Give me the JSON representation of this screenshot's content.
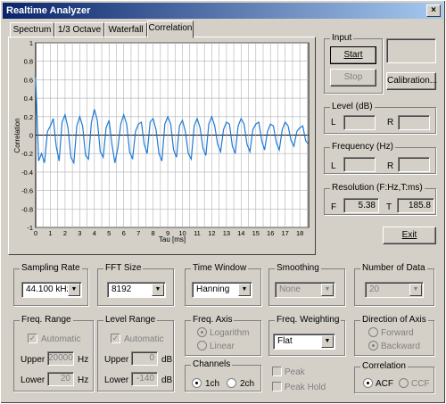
{
  "window": {
    "title": "Realtime Analyzer",
    "close_label": "×"
  },
  "tabs": [
    {
      "label": "Spectrum"
    },
    {
      "label": "1/3 Octave"
    },
    {
      "label": "Waterfall"
    },
    {
      "label": "Correlation",
      "active": true
    }
  ],
  "input": {
    "title": "Input",
    "start_label": "Start",
    "stop_label": "Stop",
    "calibration_label": "Calibration..."
  },
  "level": {
    "title": "Level (dB)",
    "l_label": "L",
    "r_label": "R",
    "l_value": "",
    "r_value": ""
  },
  "frequency": {
    "title": "Frequency (Hz)",
    "l_label": "L",
    "r_label": "R",
    "l_value": "",
    "r_value": ""
  },
  "resolution": {
    "title": "Resolution (F:Hz,T:ms)",
    "f_label": "F",
    "f_value": "5.38",
    "t_label": "T",
    "t_value": "185.8"
  },
  "exit_label": "Exit",
  "sampling_rate": {
    "title": "Sampling Rate",
    "value": "44.100 kHz"
  },
  "fft_size": {
    "title": "FFT Size",
    "value": "8192"
  },
  "time_window": {
    "title": "Time Window",
    "value": "Hanning"
  },
  "smoothing": {
    "title": "Smoothing",
    "value": "None"
  },
  "number_of_data": {
    "title": "Number of Data",
    "value": "20"
  },
  "freq_range": {
    "title": "Freq. Range",
    "automatic_label": "Automatic",
    "upper_label": "Upper",
    "upper_value": "20000",
    "upper_unit": "Hz",
    "lower_label": "Lower",
    "lower_value": "20",
    "lower_unit": "Hz"
  },
  "level_range": {
    "title": "Level Range",
    "automatic_label": "Automatic",
    "upper_label": "Upper",
    "upper_value": "0",
    "upper_unit": "dB",
    "lower_label": "Lower",
    "lower_value": "-140",
    "lower_unit": "dB"
  },
  "freq_axis": {
    "title": "Freq. Axis",
    "logarithm_label": "Logarithm",
    "linear_label": "Linear"
  },
  "freq_weighting": {
    "title": "Freq. Weighting",
    "value": "Flat"
  },
  "direction": {
    "title": "Direction of Axis",
    "forward_label": "Forward",
    "backward_label": "Backward"
  },
  "channels": {
    "title": "Channels",
    "ch1_label": "1ch",
    "ch2_label": "2ch"
  },
  "peak": {
    "peak_label": "Peak",
    "peak_hold_label": "Peak Hold"
  },
  "correlation": {
    "title": "Correlation",
    "acf_label": "ACF",
    "ccf_label": "CCF"
  },
  "chart_data": {
    "type": "line",
    "xlabel": "Tau [ms]",
    "ylabel": "Correlation",
    "xlim": [
      0,
      18.6
    ],
    "ylim": [
      -1,
      1
    ],
    "grid": true,
    "series_color": "#1e7ad6",
    "x_ticks": [
      "0",
      "1",
      "2",
      "3",
      "4",
      "5",
      "6",
      "7",
      "8",
      "9",
      "10",
      "11",
      "12",
      "13",
      "14",
      "15",
      "16",
      "17",
      "18"
    ],
    "y_ticks": [
      "1",
      "0.8",
      "0.6",
      "0.4",
      "0.2",
      "0",
      "-0.2",
      "-0.4",
      "-0.6",
      "-0.8",
      "-1"
    ],
    "series": [
      {
        "x": [
          0,
          0.2,
          0.4,
          0.6,
          0.8,
          1.0,
          1.2,
          1.4,
          1.6,
          1.8,
          2.0,
          2.2,
          2.4,
          2.6,
          2.8,
          3.0,
          3.2,
          3.4,
          3.6,
          3.8,
          4.0,
          4.2,
          4.4,
          4.6,
          4.8,
          5.0,
          5.2,
          5.4,
          5.6,
          5.8,
          6.0,
          6.2,
          6.4,
          6.6,
          6.8,
          7.0,
          7.2,
          7.4,
          7.6,
          7.8,
          8.0,
          8.2,
          8.4,
          8.6,
          8.8,
          9.0,
          9.2,
          9.4,
          9.6,
          9.8,
          10.0,
          10.2,
          10.4,
          10.6,
          10.8,
          11.0,
          11.2,
          11.4,
          11.6,
          11.8,
          12.0,
          12.2,
          12.4,
          12.6,
          12.8,
          13.0,
          13.2,
          13.4,
          13.6,
          13.8,
          14.0,
          14.2,
          14.4,
          14.6,
          14.8,
          15.0,
          15.2,
          15.4,
          15.6,
          15.8,
          16.0,
          16.2,
          16.4,
          16.6,
          16.8,
          17.0,
          17.2,
          17.4,
          17.6,
          17.8,
          18.0,
          18.2,
          18.4,
          18.6
        ],
        "y": [
          0.62,
          -0.28,
          -0.2,
          -0.3,
          0.04,
          0.1,
          0.18,
          -0.12,
          -0.28,
          0.14,
          0.22,
          0.08,
          -0.24,
          -0.3,
          0.1,
          0.2,
          0.1,
          -0.22,
          -0.26,
          0.14,
          0.28,
          0.16,
          -0.18,
          -0.24,
          0.08,
          0.16,
          -0.1,
          -0.3,
          -0.14,
          0.12,
          0.22,
          0.12,
          -0.18,
          -0.26,
          0.04,
          0.12,
          0.14,
          -0.1,
          -0.2,
          0.14,
          0.18,
          0.06,
          -0.2,
          -0.28,
          0.12,
          0.2,
          0.12,
          -0.16,
          -0.24,
          0.1,
          0.16,
          0.04,
          -0.2,
          -0.26,
          0.1,
          0.18,
          0.08,
          -0.14,
          -0.22,
          0.12,
          0.2,
          0.1,
          -0.1,
          -0.18,
          0.06,
          0.14,
          0.12,
          -0.12,
          -0.2,
          0.1,
          0.18,
          0.12,
          -0.1,
          -0.18,
          0.06,
          0.12,
          0.14,
          -0.06,
          -0.16,
          0.04,
          0.12,
          0.1,
          -0.08,
          -0.16,
          0.06,
          0.14,
          0.1,
          -0.06,
          -0.12,
          0.04,
          0.08,
          0.1,
          -0.06,
          -0.1
        ]
      }
    ]
  }
}
